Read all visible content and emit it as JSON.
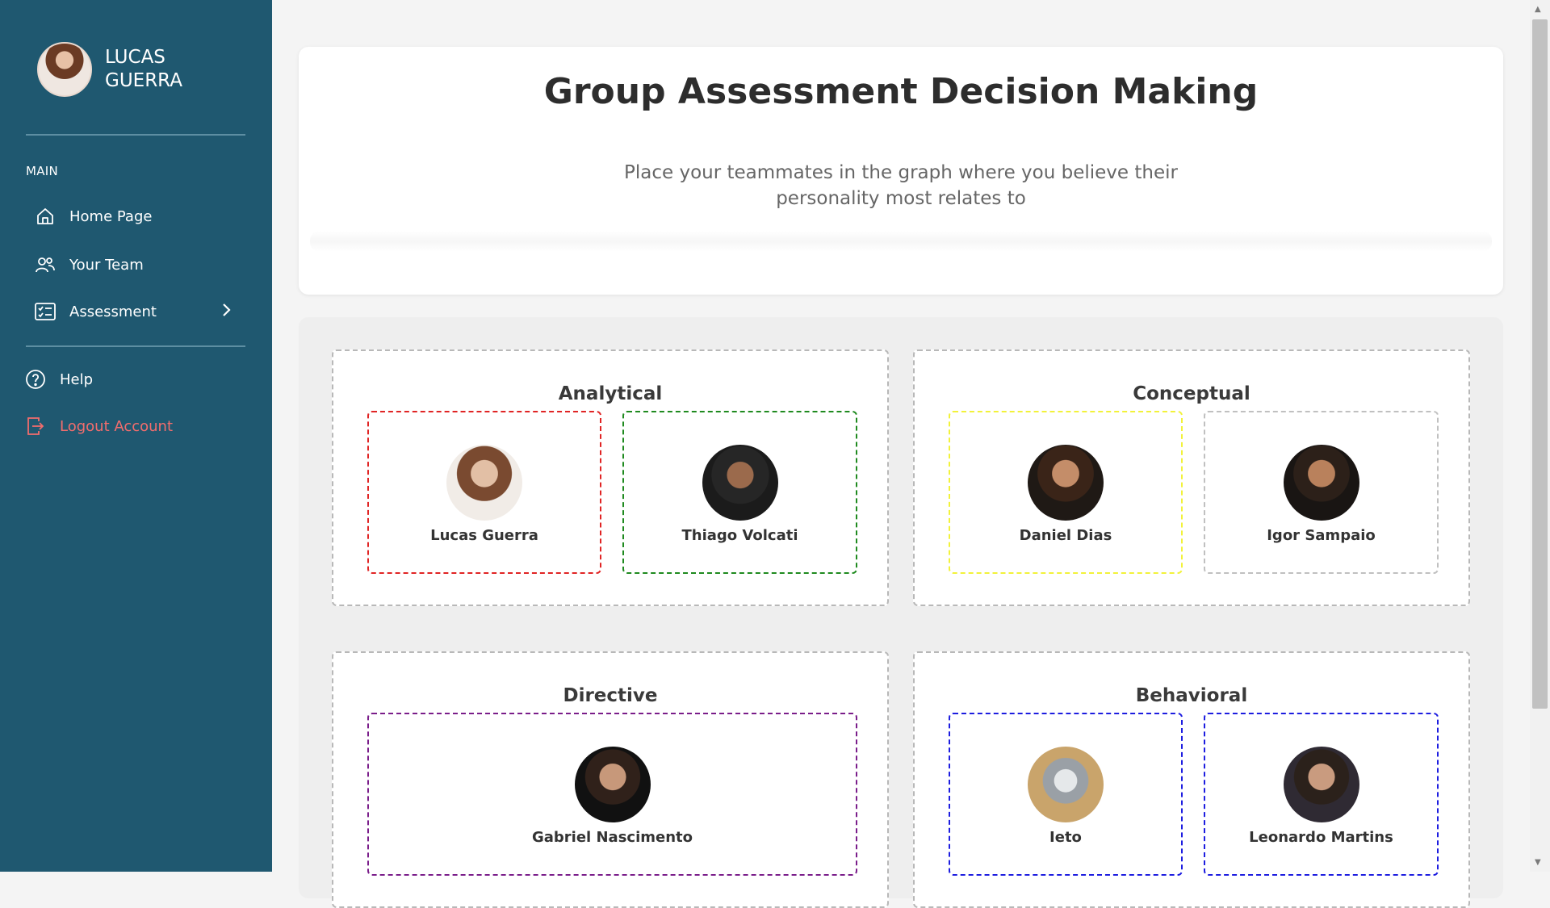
{
  "user": {
    "name": "LUCAS GUERRA"
  },
  "sidebar": {
    "section_label": "MAIN",
    "items": [
      {
        "label": "Home Page",
        "icon": "home-icon"
      },
      {
        "label": "Your Team",
        "icon": "users-icon"
      },
      {
        "label": "Assessment",
        "icon": "checklist-icon"
      }
    ],
    "help": "Help",
    "logout": "Logout Account"
  },
  "header": {
    "title": "Group Assessment Decision Making",
    "subtitle": "Place your teammates in the graph where you believe their personality most relates to"
  },
  "quadrants": [
    {
      "title": "Analytical",
      "members": [
        "Lucas Guerra",
        "Thiago Volcati"
      ]
    },
    {
      "title": "Conceptual",
      "members": [
        "Daniel Dias",
        "Igor Sampaio"
      ]
    },
    {
      "title": "Directive",
      "members": [
        "Gabriel Nascimento"
      ]
    },
    {
      "title": "Behavioral",
      "members": [
        "Ieto",
        "Leonardo Martins"
      ]
    }
  ],
  "colors": {
    "sidebar": "#1f5870",
    "logout": "#f26d6d",
    "slot_red": "#e02424",
    "slot_green": "#1f8a1f",
    "slot_yellow": "#f2f23a",
    "slot_gray": "#c0c0c0",
    "slot_purple": "#7a1d8a",
    "slot_blue": "#1d1de0"
  }
}
